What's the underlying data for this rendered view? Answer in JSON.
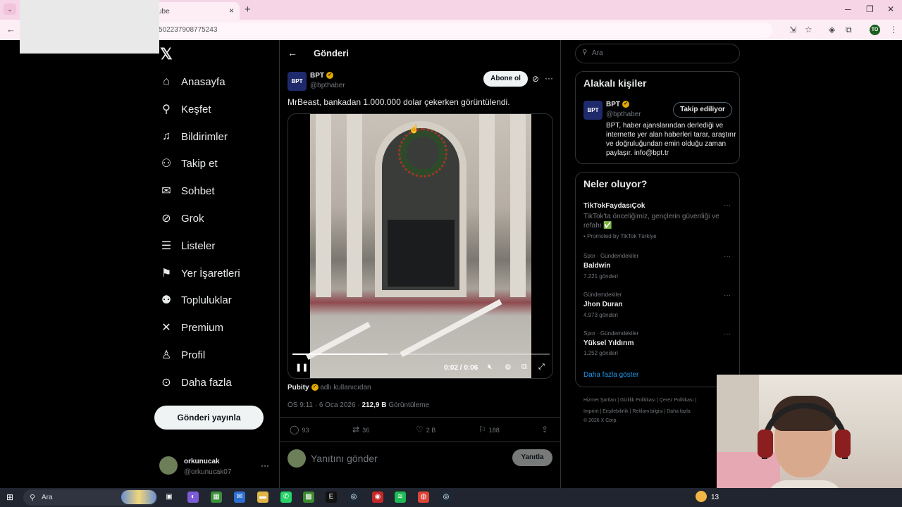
{
  "browser": {
    "tab_title": "ube",
    "url": "502237908775243",
    "profile_initials": "TO",
    "icons": [
      "tab-menu-icon",
      "close-icon",
      "plus-icon",
      "minimize-icon",
      "restore-icon",
      "close-window-icon",
      "back-icon",
      "install-icon",
      "star-icon",
      "extension-icon",
      "kebab-icon"
    ]
  },
  "nav": {
    "items": [
      {
        "label": "Anasayfa",
        "icon": "home-icon"
      },
      {
        "label": "Keşfet",
        "icon": "search-icon"
      },
      {
        "label": "Bildirimler",
        "icon": "bell-icon"
      },
      {
        "label": "Takip et",
        "icon": "add-person-icon"
      },
      {
        "label": "Sohbet",
        "icon": "mail-icon"
      },
      {
        "label": "Grok",
        "icon": "grok-icon"
      },
      {
        "label": "Listeler",
        "icon": "list-icon"
      },
      {
        "label": "Yer İşaretleri",
        "icon": "bookmark-icon"
      },
      {
        "label": "Topluluklar",
        "icon": "communities-icon"
      },
      {
        "label": "Premium",
        "icon": "x-icon"
      },
      {
        "label": "Profil",
        "icon": "person-icon"
      },
      {
        "label": "Daha fazla",
        "icon": "more-circle-icon"
      }
    ],
    "post_button": "Gönderi yayınla",
    "account": {
      "name": "orkunucak",
      "handle": "@orkunucak07"
    }
  },
  "post": {
    "header_title": "Gönderi",
    "author_name": "BPT",
    "author_handle": "@bpthaber",
    "author_logo": "BPT",
    "subscribe_label": "Abone ol",
    "text": "MrBeast, bankadan 1.000.000 dolar çekerken görüntülendi.",
    "video": {
      "time": "0:02 / 0:06",
      "progress": 0.37
    },
    "from_name": "Pubity",
    "from_suffix": "adlı kullanıcıdan",
    "timestamp": "ÖS 9:11 · 6 Oca 2026 ·",
    "views": "212,9 B",
    "views_label": "Görüntüleme",
    "stats": {
      "replies": "93",
      "reposts": "36",
      "likes": "2 B",
      "bookmarks": "188"
    },
    "reply_placeholder": "Yanıtını gönder",
    "reply_button": "Yanıtla"
  },
  "sidebar": {
    "search_placeholder": "Ara",
    "relevant": {
      "title": "Alakalı kişiler",
      "name": "BPT",
      "handle": "@bpthaber",
      "following_label": "Takip ediliyor",
      "bio": "BPT, haber ajanslarından derlediği ve internette yer alan haberleri tarar, araştırır ve doğruluğundan emin olduğu zaman paylaşır. info@bpt.tr"
    },
    "trends": {
      "title": "Neler oluyor?",
      "promoted": {
        "title": "TikTokFaydasıÇok",
        "desc": "TikTok'ta önceliğimiz, gençlerin güvenliği ve refahı ✅",
        "by": "Promoted by TikTok Türkiye"
      },
      "items": [
        {
          "category": "Spor · Gündemdekiler",
          "title": "Baldwin",
          "count": "7.221 gönderi"
        },
        {
          "category": "Gündemdekiler",
          "title": "Jhon Duran",
          "count": "4.973 gönderi"
        },
        {
          "category": "Spor · Gündemdekiler",
          "title": "Yüksel Yıldırım",
          "count": "1.252 gönderi"
        }
      ],
      "show_more": "Daha fazla göster"
    },
    "footer": {
      "line1": "Hizmet Şartları  |  Gizlilik Politikası  |  Çerez Politikası  |",
      "line2": "Imprint  |  Erişilebilirlik  |  Reklam bilgisi  |  Daha fazla",
      "line3": "© 2026 X Corp."
    }
  },
  "taskbar": {
    "search_label": "Ara",
    "clock_partial": "13"
  }
}
